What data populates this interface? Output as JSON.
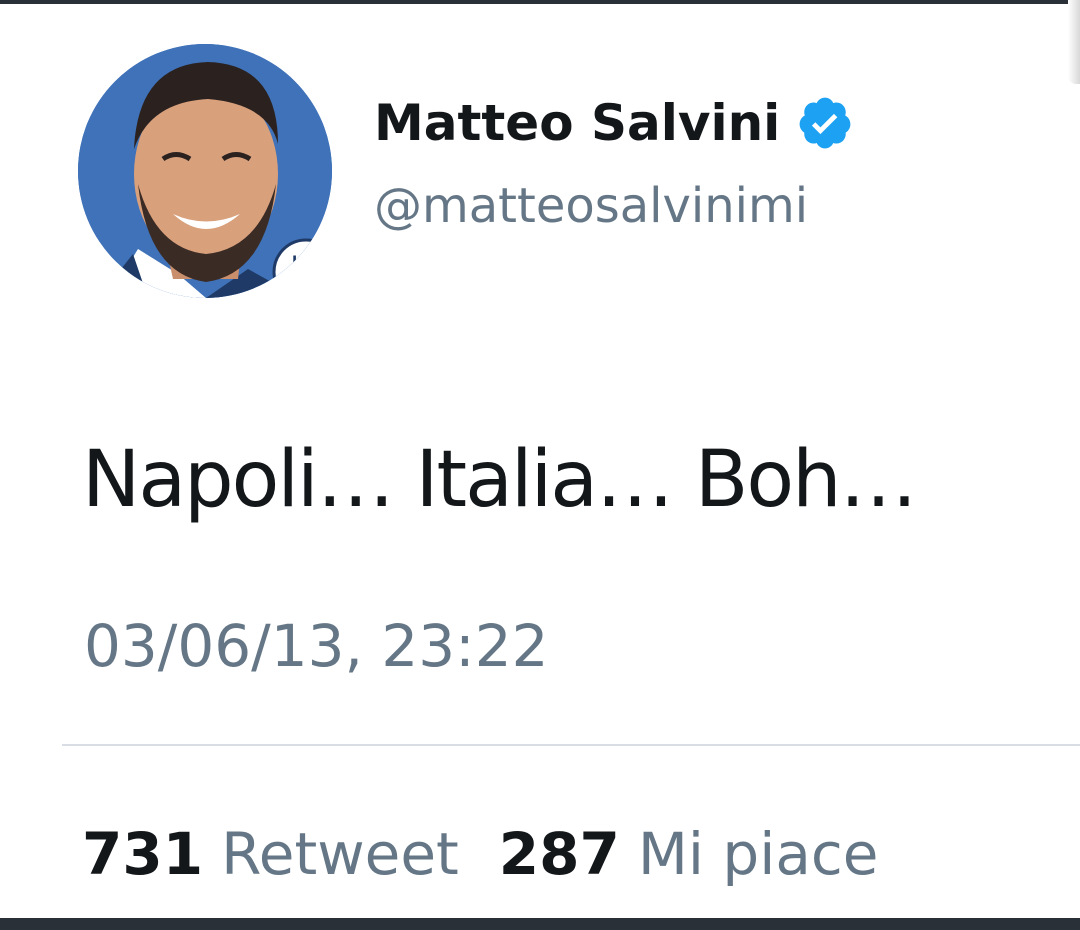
{
  "user": {
    "display_name": "Matteo Salvini",
    "handle": "@matteosalvinimi",
    "verified": true,
    "verified_color": "#1da1f2",
    "avatar_badge_text": "LEGA"
  },
  "tweet": {
    "text": "Napoli… Italia… Boh…",
    "timestamp": "03/06/13, 23:22"
  },
  "stats": {
    "retweets_count": "731",
    "retweets_label": "Retweet",
    "likes_count": "287",
    "likes_label": "Mi piace"
  }
}
